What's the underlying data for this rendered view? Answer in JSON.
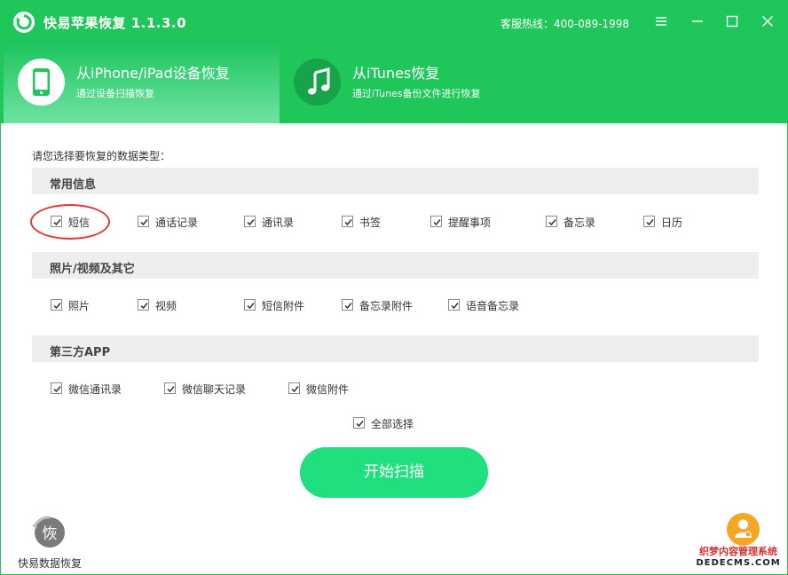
{
  "app": {
    "title": "快易苹果恢复 1.1.3.0",
    "hotline": "客服热线：400-089-1998",
    "accent_color": "#1fc75a"
  },
  "window_controls": {
    "menu": "menu-icon",
    "minimize": "minimize-icon",
    "maximize": "maximize-icon",
    "close": "close-icon"
  },
  "tabs": [
    {
      "title": "从iPhone/iPad设备恢复",
      "subtitle": "通过设备扫描恢复",
      "icon": "phone-icon",
      "active": true
    },
    {
      "title": "从iTunes恢复",
      "subtitle": "通过iTunes备份文件进行恢复",
      "icon": "music-note-icon",
      "active": false
    }
  ],
  "prompt": "请您选择要恢复的数据类型：",
  "sections": [
    {
      "title": "常用信息",
      "options": [
        {
          "label": "短信",
          "checked": true
        },
        {
          "label": "通话记录",
          "checked": true
        },
        {
          "label": "通讯录",
          "checked": true
        },
        {
          "label": "书签",
          "checked": true
        },
        {
          "label": "提醒事项",
          "checked": true
        },
        {
          "label": "备忘录",
          "checked": true
        },
        {
          "label": "日历",
          "checked": true
        }
      ]
    },
    {
      "title": "照片/视频及其它",
      "options": [
        {
          "label": "照片",
          "checked": true
        },
        {
          "label": "视频",
          "checked": true
        },
        {
          "label": "短信附件",
          "checked": true
        },
        {
          "label": "备忘录附件",
          "checked": true
        },
        {
          "label": "语音备忘录",
          "checked": true
        }
      ]
    },
    {
      "title": "第三方APP",
      "options": [
        {
          "label": "微信通讯录",
          "checked": true
        },
        {
          "label": "微信聊天记录",
          "checked": true
        },
        {
          "label": "微信附件",
          "checked": true
        }
      ]
    }
  ],
  "select_all": {
    "label": "全部选择",
    "checked": true
  },
  "scan_button": "开始扫描",
  "brand": {
    "logo_char": "恢",
    "name": "快易数据恢复"
  },
  "watermark": {
    "line1": "织梦内容管理系统",
    "line2": "DEDECMS.COM"
  },
  "highlight_color": "#e53935"
}
